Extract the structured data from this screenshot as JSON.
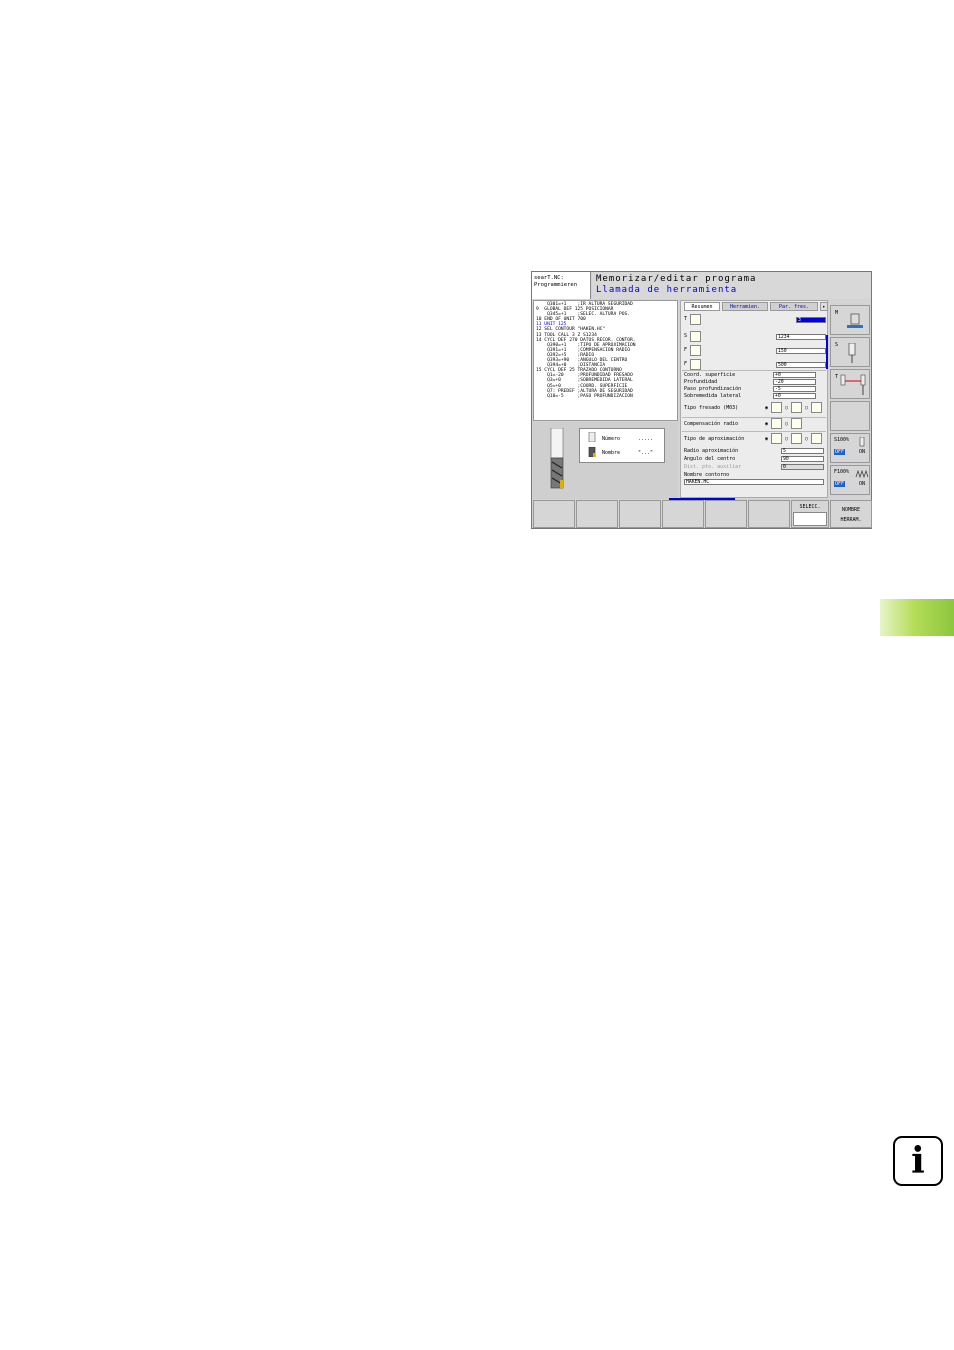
{
  "screen": {
    "mode_label_1": "searT.NC:",
    "mode_label_2": "Programmieren",
    "title_1": "Memorizar/editar programa",
    "title_2": "Llamada de herramienta",
    "program_lines": [
      {
        "text": "    Q301=+1    ;IR ALTURA SEGURIDAD",
        "hl": false
      },
      {
        "text": "9  GLOBAL DEF 125 POSICIONAR",
        "hl": false
      },
      {
        "text": "    Q345=+1    ;SELEC. ALTURA POS.",
        "hl": false
      },
      {
        "text": "10 END OF UNIT 700",
        "hl": false
      },
      {
        "text": "11 UNIT 125",
        "hl": true
      },
      {
        "text": "12 SEL CONTOUR \"HAKEN.HC\"",
        "hl": false
      },
      {
        "text": "13 TOOL CALL 3 Z S1234",
        "hl": false
      },
      {
        "text": "14 CYCL DEF 270 DATOS RECOR. CONTOR.",
        "hl": false
      },
      {
        "text": "    Q390=+1    ;TIPO DE APROXIMACION",
        "hl": false
      },
      {
        "text": "    Q391=+1    ;COMPENSACION RADIO",
        "hl": false
      },
      {
        "text": "    Q392=+5    ;RADIO",
        "hl": false
      },
      {
        "text": "    Q393=+90   ;ANGULO DEL CENTRO",
        "hl": false
      },
      {
        "text": "    Q394=+0    ;DISTANCIA",
        "hl": false
      },
      {
        "text": "15 CYCL DEF 25 TRAZADO CONTORNO",
        "hl": false
      },
      {
        "text": "    Q1=-20     ;PROFUNDIDAD FRESADO",
        "hl": false
      },
      {
        "text": "    Q3=+0      ;SOBREMEDIDA LATERAL",
        "hl": false
      },
      {
        "text": "    Q5=+0      ;COORD. SUPERFICIE",
        "hl": false
      },
      {
        "text": "    Q7: PREDEF ;ALTURA DE SEGURIDAD",
        "hl": false
      },
      {
        "text": "    Q10=-5     ;PASO PROFUNDIZACION",
        "hl": false
      }
    ],
    "info_box": {
      "numero_label": "Número",
      "numero_value": ".....",
      "nombre_label": "Nombre",
      "nombre_value": "\"...\""
    },
    "tabs": [
      "Resumen",
      "Herramien.",
      "Par. fres."
    ],
    "tab_arrow": "▸",
    "fields": {
      "t_label": "T",
      "t_value": "3",
      "s_label": "S",
      "s_value": "1234",
      "f1_label": "F",
      "f1_value": "150",
      "f2_label": "F",
      "f2_value": "500",
      "coord_label": "Coord. superficie",
      "coord_value": "+0",
      "prof_label": "Profundidad",
      "prof_value": "-20",
      "paso_label": "Paso profundización",
      "paso_value": "-5",
      "sobre_label": "Sobremedida lateral",
      "sobre_value": "+0",
      "tipo_fresado_label": "Tipo fresado (M03)",
      "comp_radio_label": "Compensación radio",
      "tipo_aprox_label": "Tipo de aproximación",
      "radio_aprox_label": "Radio aproximación",
      "radio_aprox_value": "5",
      "angulo_label": "Angulo del centro",
      "angulo_value": "90",
      "dist_label": "Dist. pto. auxiliar",
      "dist_value": "0",
      "nombre_contorno_label": "Nombre contorno",
      "nombre_contorno_value": "HAKEN.HC"
    },
    "vertical_softkeys": {
      "m_label": "M",
      "s_label": "S",
      "t_label": "T",
      "s100": "S100%",
      "f100": "F100%",
      "off": "OFF",
      "on": "ON"
    },
    "softkeys": {
      "selecc": "SELECC.",
      "nombre_1": "NOMBRE",
      "nombre_2": "HERRAM."
    }
  },
  "colors": {
    "green_tab": "#8cc63f",
    "title_blue": "#0000d8",
    "off_badge": "#2060c0"
  }
}
